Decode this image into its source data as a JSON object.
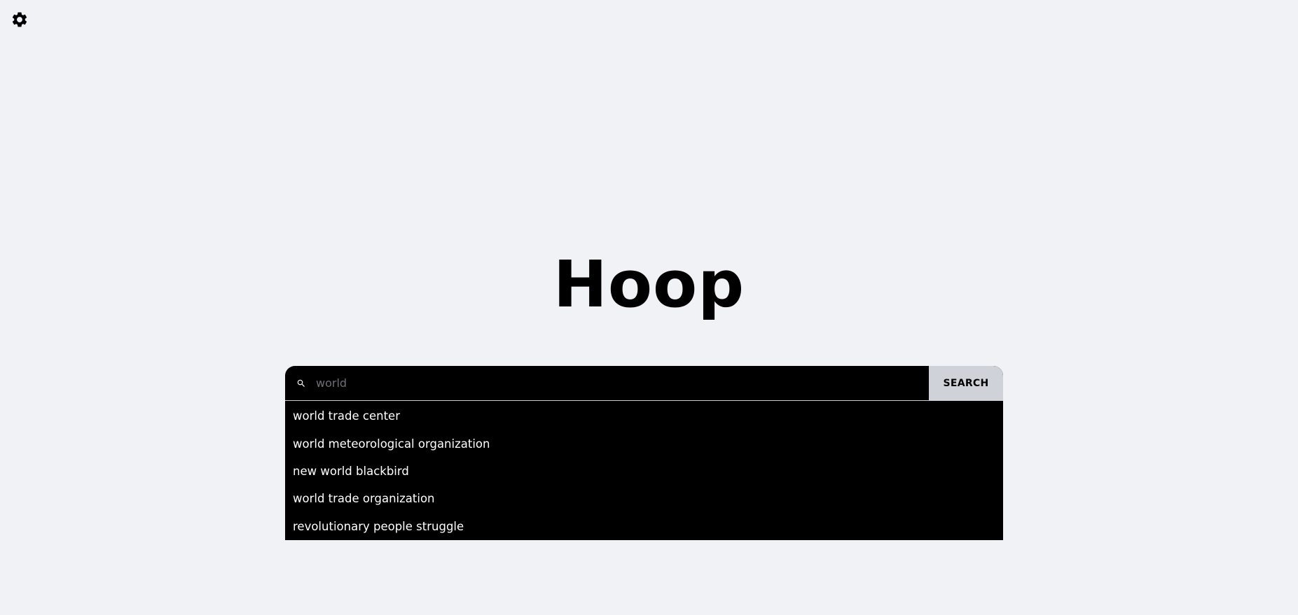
{
  "settings": {
    "icon": "gear-icon"
  },
  "logo": {
    "text": "Hoop"
  },
  "search": {
    "icon": "search-icon",
    "placeholder": "world",
    "value": "",
    "button_label": "SEARCH"
  },
  "suggestions": {
    "items": [
      {
        "label": "world trade center"
      },
      {
        "label": "world meteorological organization"
      },
      {
        "label": "new world blackbird"
      },
      {
        "label": "world trade organization"
      },
      {
        "label": "revolutionary people struggle"
      }
    ]
  },
  "colors": {
    "background": "#f0f2f6",
    "search_bar": "#000000",
    "button": "#cfd2d8",
    "suggestion_text": "#ffffff"
  }
}
